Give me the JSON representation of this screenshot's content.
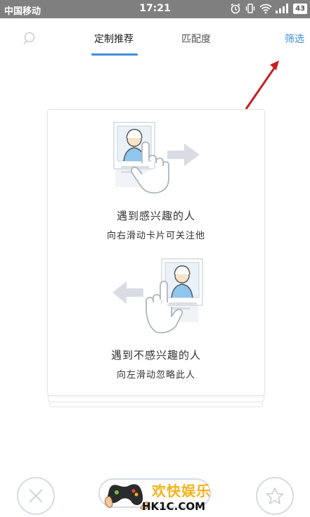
{
  "status_bar": {
    "carrier": "中国移动",
    "time": "17:21",
    "battery": "43"
  },
  "header": {
    "tabs": [
      {
        "label": "定制推荐",
        "active": true
      },
      {
        "label": "匹配度",
        "active": false
      }
    ],
    "filter_label": "筛选",
    "accent_color": "#3f8fdd"
  },
  "guide_card": {
    "right_title": "遇到感兴趣的人",
    "right_subtitle": "向右滑动卡片可关注他",
    "left_title": "遇到不感兴趣的人",
    "left_subtitle": "向左滑动忽略此人"
  },
  "bottom_bar": {
    "skip_icon": "close-icon",
    "favorite_icon": "star-icon"
  },
  "watermark": {
    "title": "欢快娱乐",
    "domain": "HK1C.COM"
  },
  "annotation_color": "#c62020"
}
